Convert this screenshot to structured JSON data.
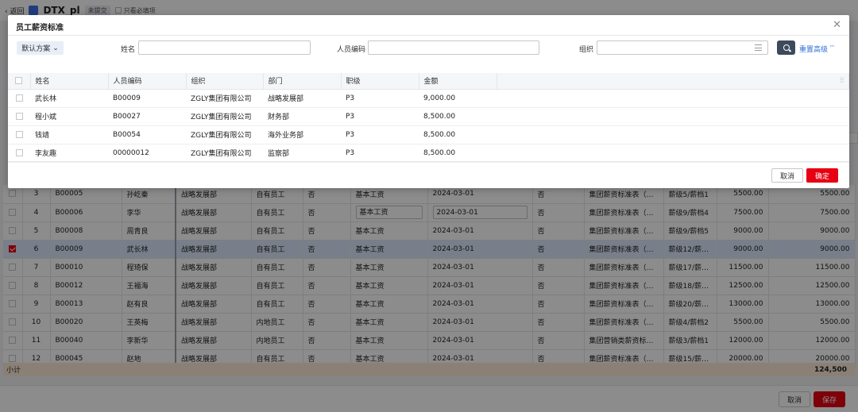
{
  "background": {
    "back_label": "‹ 返回",
    "doc_title": "DTX_pl",
    "status_tag": "未提交",
    "check_label": "只看必填项",
    "rows": [
      {
        "idx": "3",
        "code": "B00005",
        "name": "孙屹秦",
        "org": "战略发展部",
        "emp_type": "自有员工",
        "flag1": "否",
        "salary_item": "基本工资",
        "date": "2024-03-01",
        "flag2": "否",
        "standard": "集团薪资标准表（通…",
        "grade": "薪级5/薪档1",
        "amount": "5500.00",
        "amount2": "5500.00",
        "checked": false,
        "editable": false
      },
      {
        "idx": "4",
        "code": "B00006",
        "name": "李华",
        "org": "战略发展部",
        "emp_type": "自有员工",
        "flag1": "否",
        "salary_item": "基本工资",
        "date": "2024-03-01",
        "flag2": "否",
        "standard": "集团薪资标准表（通…",
        "grade": "薪级9/薪档4",
        "amount": "7500.00",
        "amount2": "7500.00",
        "checked": false,
        "editable": true
      },
      {
        "idx": "5",
        "code": "B00008",
        "name": "周青良",
        "org": "战略发展部",
        "emp_type": "自有员工",
        "flag1": "否",
        "salary_item": "基本工资",
        "date": "2024-03-01",
        "flag2": "否",
        "standard": "集团薪资标准表（通…",
        "grade": "薪级9/薪档5",
        "amount": "9000.00",
        "amount2": "9000.00",
        "checked": false,
        "editable": false
      },
      {
        "idx": "6",
        "code": "B00009",
        "name": "武长林",
        "org": "战略发展部",
        "emp_type": "自有员工",
        "flag1": "否",
        "salary_item": "基本工资",
        "date": "2024-03-01",
        "flag2": "否",
        "standard": "集团薪资标准表（通…",
        "grade": "薪级12/薪…",
        "amount": "9000.00",
        "amount2": "9000.00",
        "checked": true,
        "editable": false
      },
      {
        "idx": "7",
        "code": "B00010",
        "name": "程琦保",
        "org": "战略发展部",
        "emp_type": "自有员工",
        "flag1": "否",
        "salary_item": "基本工资",
        "date": "2024-03-01",
        "flag2": "否",
        "standard": "集团薪资标准表（通…",
        "grade": "薪级17/薪…",
        "amount": "11500.00",
        "amount2": "11500.00",
        "checked": false,
        "editable": false
      },
      {
        "idx": "8",
        "code": "B00012",
        "name": "王福海",
        "org": "战略发展部",
        "emp_type": "自有员工",
        "flag1": "否",
        "salary_item": "基本工资",
        "date": "2024-03-01",
        "flag2": "否",
        "standard": "集团薪资标准表（通…",
        "grade": "薪级18/薪…",
        "amount": "12500.00",
        "amount2": "12500.00",
        "checked": false,
        "editable": false
      },
      {
        "idx": "9",
        "code": "B00013",
        "name": "赵有良",
        "org": "战略发展部",
        "emp_type": "自有员工",
        "flag1": "否",
        "salary_item": "基本工资",
        "date": "2024-03-01",
        "flag2": "否",
        "standard": "集团薪资标准表（通…",
        "grade": "薪级20/薪…",
        "amount": "13000.00",
        "amount2": "13000.00",
        "checked": false,
        "editable": false
      },
      {
        "idx": "10",
        "code": "B00020",
        "name": "王英梅",
        "org": "战略发展部",
        "emp_type": "内地员工",
        "flag1": "否",
        "salary_item": "基本工资",
        "date": "2024-03-01",
        "flag2": "否",
        "standard": "集团薪资标准表（通…",
        "grade": "薪级4/薪档2",
        "amount": "5500.00",
        "amount2": "5500.00",
        "checked": false,
        "editable": false
      },
      {
        "idx": "11",
        "code": "B00040",
        "name": "李新华",
        "org": "战略发展部",
        "emp_type": "内地员工",
        "flag1": "否",
        "salary_item": "基本工资",
        "date": "2024-03-01",
        "flag2": "否",
        "standard": "集团营销类薪资标准…",
        "grade": "薪级3/薪档1",
        "amount": "12000.00",
        "amount2": "12000.00",
        "checked": false,
        "editable": false
      },
      {
        "idx": "12",
        "code": "B00045",
        "name": "赵地",
        "org": "战略发展部",
        "emp_type": "自有员工",
        "flag1": "否",
        "salary_item": "基本工资",
        "date": "2024-03-01",
        "flag2": "否",
        "standard": "集团薪资标准表（通…",
        "grade": "薪级15/薪…",
        "amount": "20000.00",
        "amount2": "20000.00",
        "checked": false,
        "editable": false
      }
    ],
    "subtotal_label": "小计",
    "subtotal_value": "124,500",
    "cancel_label": "取消",
    "save_label": "保存"
  },
  "modal": {
    "title": "员工薪资标准",
    "scheme_label": "默认方案",
    "filters": {
      "name_label": "姓名",
      "code_label": "人员编码",
      "org_label": "组织"
    },
    "reset_label": "重置",
    "advanced_label": "高级",
    "more_label": "···",
    "columns": [
      "姓名",
      "人员编码",
      "组织",
      "部门",
      "职级",
      "金额"
    ],
    "rows": [
      {
        "name": "武长林",
        "code": "B00009",
        "org": "ZGLY集团有限公司",
        "dept": "战略发展部",
        "rank": "P3",
        "amount": "9,000.00"
      },
      {
        "name": "程小斌",
        "code": "B00027",
        "org": "ZGLY集团有限公司",
        "dept": "财务部",
        "rank": "P3",
        "amount": "8,500.00"
      },
      {
        "name": "钱靖",
        "code": "B00054",
        "org": "ZGLY集团有限公司",
        "dept": "海外业务部",
        "rank": "P3",
        "amount": "8,500.00"
      },
      {
        "name": "李友趣",
        "code": "00000012",
        "org": "ZGLY集团有限公司",
        "dept": "监察部",
        "rank": "P3",
        "amount": "8,500.00"
      }
    ],
    "cancel_label": "取消",
    "confirm_label": "确定"
  }
}
